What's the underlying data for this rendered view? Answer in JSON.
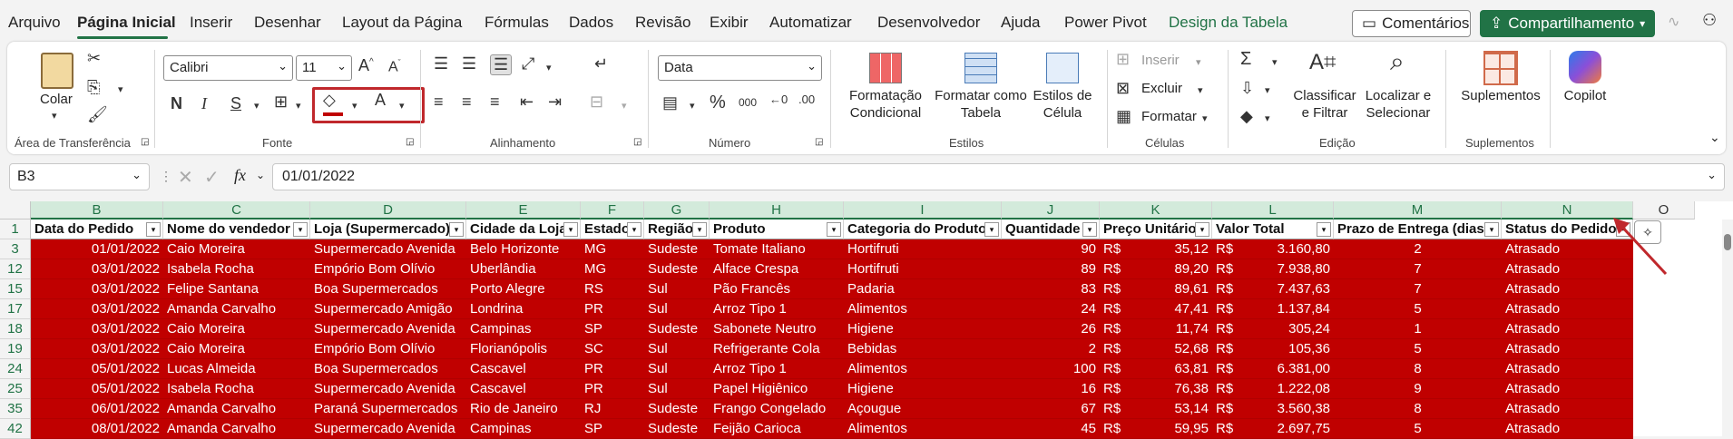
{
  "menu": {
    "items": [
      "Arquivo",
      "Página Inicial",
      "Inserir",
      "Desenhar",
      "Layout da Página",
      "Fórmulas",
      "Dados",
      "Revisão",
      "Exibir",
      "Automatizar",
      "Desenvolvedor",
      "Ajuda",
      "Power Pivot",
      "Design da Tabela"
    ],
    "active": "Página Inicial",
    "comments_label": "Comentários",
    "share_label": "Compartilhamento"
  },
  "ribbon": {
    "clipboard": {
      "paste_label": "Colar",
      "group_label": "Área de Transferência"
    },
    "font": {
      "name": "Calibri",
      "size": "11",
      "bold": "N",
      "italic": "I",
      "underline": "S",
      "group_label": "Fonte"
    },
    "alignment": {
      "group_label": "Alinhamento"
    },
    "number": {
      "format": "Data",
      "group_label": "Número"
    },
    "styles": {
      "conditional": "Formatação Condicional",
      "table": "Formatar como Tabela",
      "cell": "Estilos de Célula",
      "group_label": "Estilos"
    },
    "cells": {
      "insert": "Inserir",
      "delete": "Excluir",
      "format": "Formatar",
      "group_label": "Células"
    },
    "editing": {
      "sort": "Classificar e Filtrar",
      "find": "Localizar e Selecionar",
      "group_label": "Edição"
    },
    "addins": {
      "label": "Suplementos",
      "group_label": "Suplementos"
    },
    "copilot": {
      "label": "Copilot"
    }
  },
  "formula_bar": {
    "name_box": "B3",
    "value": "01/01/2022",
    "fx": "fx"
  },
  "columns": [
    "B",
    "C",
    "D",
    "E",
    "F",
    "G",
    "H",
    "I",
    "J",
    "K",
    "L",
    "M",
    "N",
    "O"
  ],
  "header_row": "1",
  "headers": [
    "Data do Pedido",
    "Nome do vendedor",
    "Loja (Supermercado)",
    "Cidade da Loja",
    "Estado",
    "Região",
    "Produto",
    "Categoria do Produto",
    "Quantidade",
    "Preço Unitário",
    "Valor Total",
    "Prazo de Entrega (dias)",
    "Status do Pedido"
  ],
  "rows": [
    {
      "n": "3",
      "data": "01/01/2022",
      "vend": "Caio Moreira",
      "loja": "Supermercado Avenida",
      "cidade": "Belo Horizonte",
      "uf": "MG",
      "reg": "Sudeste",
      "prod": "Tomate Italiano",
      "cat": "Hortifruti",
      "qtd": "90",
      "cur1": "R$",
      "preco": "35,12",
      "cur2": "R$",
      "total": "3.160,80",
      "prazo": "2",
      "status": "Atrasado"
    },
    {
      "n": "12",
      "data": "03/01/2022",
      "vend": "Isabela Rocha",
      "loja": "Empório Bom Olívio",
      "cidade": "Uberlândia",
      "uf": "MG",
      "reg": "Sudeste",
      "prod": "Alface Crespa",
      "cat": "Hortifruti",
      "qtd": "89",
      "cur1": "R$",
      "preco": "89,20",
      "cur2": "R$",
      "total": "7.938,80",
      "prazo": "7",
      "status": "Atrasado"
    },
    {
      "n": "15",
      "data": "03/01/2022",
      "vend": "Felipe Santana",
      "loja": "Boa Supermercados",
      "cidade": "Porto Alegre",
      "uf": "RS",
      "reg": "Sul",
      "prod": "Pão Francês",
      "cat": "Padaria",
      "qtd": "83",
      "cur1": "R$",
      "preco": "89,61",
      "cur2": "R$",
      "total": "7.437,63",
      "prazo": "7",
      "status": "Atrasado"
    },
    {
      "n": "17",
      "data": "03/01/2022",
      "vend": "Amanda Carvalho",
      "loja": "Supermercado Amigão",
      "cidade": "Londrina",
      "uf": "PR",
      "reg": "Sul",
      "prod": "Arroz Tipo 1",
      "cat": "Alimentos",
      "qtd": "24",
      "cur1": "R$",
      "preco": "47,41",
      "cur2": "R$",
      "total": "1.137,84",
      "prazo": "5",
      "status": "Atrasado"
    },
    {
      "n": "18",
      "data": "03/01/2022",
      "vend": "Caio Moreira",
      "loja": "Supermercado Avenida",
      "cidade": "Campinas",
      "uf": "SP",
      "reg": "Sudeste",
      "prod": "Sabonete Neutro",
      "cat": "Higiene",
      "qtd": "26",
      "cur1": "R$",
      "preco": "11,74",
      "cur2": "R$",
      "total": "305,24",
      "prazo": "1",
      "status": "Atrasado"
    },
    {
      "n": "19",
      "data": "03/01/2022",
      "vend": "Caio Moreira",
      "loja": "Empório Bom Olívio",
      "cidade": "Florianópolis",
      "uf": "SC",
      "reg": "Sul",
      "prod": "Refrigerante Cola",
      "cat": "Bebidas",
      "qtd": "2",
      "cur1": "R$",
      "preco": "52,68",
      "cur2": "R$",
      "total": "105,36",
      "prazo": "5",
      "status": "Atrasado"
    },
    {
      "n": "24",
      "data": "05/01/2022",
      "vend": "Lucas Almeida",
      "loja": "Boa Supermercados",
      "cidade": "Cascavel",
      "uf": "PR",
      "reg": "Sul",
      "prod": "Arroz Tipo 1",
      "cat": "Alimentos",
      "qtd": "100",
      "cur1": "R$",
      "preco": "63,81",
      "cur2": "R$",
      "total": "6.381,00",
      "prazo": "8",
      "status": "Atrasado"
    },
    {
      "n": "25",
      "data": "05/01/2022",
      "vend": "Isabela Rocha",
      "loja": "Supermercado Avenida",
      "cidade": "Cascavel",
      "uf": "PR",
      "reg": "Sul",
      "prod": "Papel Higiênico",
      "cat": "Higiene",
      "qtd": "16",
      "cur1": "R$",
      "preco": "76,38",
      "cur2": "R$",
      "total": "1.222,08",
      "prazo": "9",
      "status": "Atrasado"
    },
    {
      "n": "35",
      "data": "06/01/2022",
      "vend": "Amanda Carvalho",
      "loja": "Paraná Supermercados",
      "cidade": "Rio de Janeiro",
      "uf": "RJ",
      "reg": "Sudeste",
      "prod": "Frango Congelado",
      "cat": "Açougue",
      "qtd": "67",
      "cur1": "R$",
      "preco": "53,14",
      "cur2": "R$",
      "total": "3.560,38",
      "prazo": "8",
      "status": "Atrasado"
    },
    {
      "n": "42",
      "data": "08/01/2022",
      "vend": "Amanda Carvalho",
      "loja": "Supermercado Avenida",
      "cidade": "Campinas",
      "uf": "SP",
      "reg": "Sudeste",
      "prod": "Feijão Carioca",
      "cat": "Alimentos",
      "qtd": "45",
      "cur1": "R$",
      "preco": "59,95",
      "cur2": "R$",
      "total": "2.697,75",
      "prazo": "5",
      "status": "Atrasado"
    }
  ],
  "colors": {
    "fill_red": "#c00000",
    "excel_green": "#217346",
    "highlight_box": "#c0282c"
  }
}
